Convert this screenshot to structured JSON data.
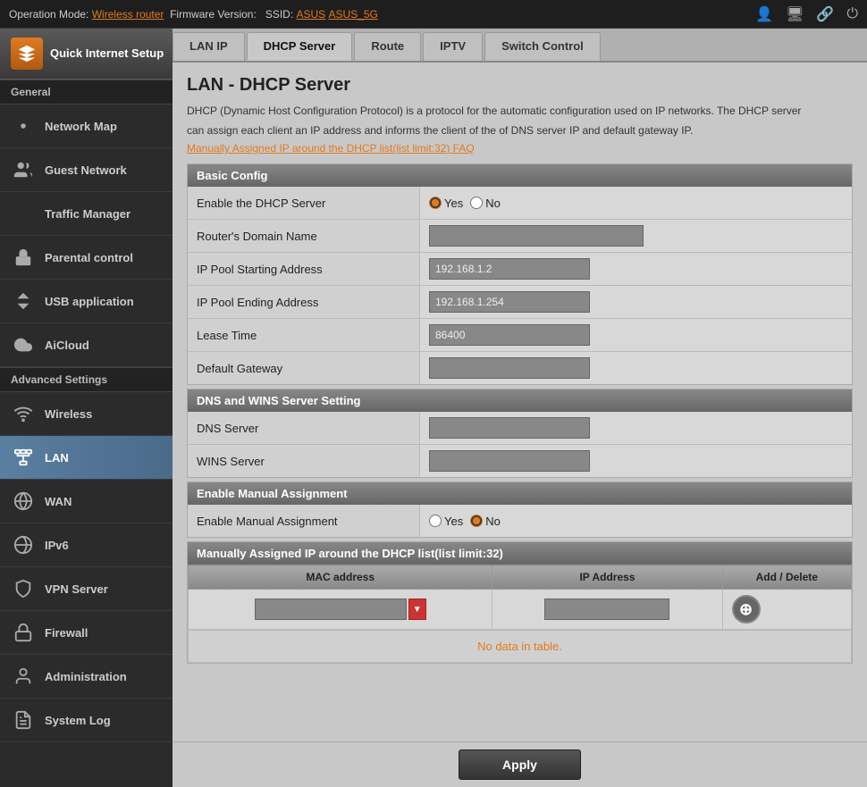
{
  "topbar": {
    "operation_mode_label": "Operation Mode:",
    "operation_mode_value": "Wireless router",
    "firmware_label": "Firmware Version:",
    "ssid_label": "SSID:",
    "ssid_value": "ASUS",
    "ssid_5g_value": "ASUS_5G"
  },
  "sidebar": {
    "quick_setup_label": "Quick Internet Setup",
    "general_label": "General",
    "items_general": [
      {
        "id": "network-map",
        "label": "Network Map"
      },
      {
        "id": "guest-network",
        "label": "Guest Network"
      },
      {
        "id": "traffic-manager",
        "label": "Traffic Manager"
      },
      {
        "id": "parental-control",
        "label": "Parental control"
      },
      {
        "id": "usb-application",
        "label": "USB application"
      },
      {
        "id": "aicloud",
        "label": "AiCloud"
      }
    ],
    "advanced_label": "Advanced Settings",
    "items_advanced": [
      {
        "id": "wireless",
        "label": "Wireless"
      },
      {
        "id": "lan",
        "label": "LAN",
        "active": true
      },
      {
        "id": "wan",
        "label": "WAN"
      },
      {
        "id": "ipv6",
        "label": "IPv6"
      },
      {
        "id": "vpn-server",
        "label": "VPN Server"
      },
      {
        "id": "firewall",
        "label": "Firewall"
      },
      {
        "id": "administration",
        "label": "Administration"
      },
      {
        "id": "system-log",
        "label": "System Log"
      }
    ]
  },
  "tabs": [
    {
      "id": "lan-ip",
      "label": "LAN IP"
    },
    {
      "id": "dhcp-server",
      "label": "DHCP Server",
      "active": true
    },
    {
      "id": "route",
      "label": "Route"
    },
    {
      "id": "iptv",
      "label": "IPTV"
    },
    {
      "id": "switch-control",
      "label": "Switch Control"
    }
  ],
  "page": {
    "title": "LAN - DHCP Server",
    "description1": "DHCP (Dynamic Host Configuration Protocol) is a protocol for the automatic configuration used on IP networks. The DHCP server",
    "description2": "can assign each client an IP address and informs the client of the of DNS server IP and default gateway IP.",
    "faq_link": "Manually Assigned IP around the DHCP list(list limit:32) FAQ"
  },
  "basic_config": {
    "header": "Basic Config",
    "fields": [
      {
        "id": "enable-dhcp",
        "label": "Enable the DHCP Server",
        "type": "radio",
        "options": [
          "Yes",
          "No"
        ],
        "selected": "Yes"
      },
      {
        "id": "router-domain",
        "label": "Router's Domain Name",
        "type": "text",
        "value": ""
      },
      {
        "id": "ip-pool-start",
        "label": "IP Pool Starting Address",
        "type": "text",
        "value": "192.168.1.2"
      },
      {
        "id": "ip-pool-end",
        "label": "IP Pool Ending Address",
        "type": "text",
        "value": "192.168.1.254"
      },
      {
        "id": "lease-time",
        "label": "Lease Time",
        "type": "text",
        "value": "86400"
      },
      {
        "id": "default-gateway",
        "label": "Default Gateway",
        "type": "text",
        "value": ""
      }
    ]
  },
  "dns_wins": {
    "header": "DNS and WINS Server Setting",
    "fields": [
      {
        "id": "dns-server",
        "label": "DNS Server",
        "type": "text",
        "value": ""
      },
      {
        "id": "wins-server",
        "label": "WINS Server",
        "type": "text",
        "value": ""
      }
    ]
  },
  "manual_assignment": {
    "header": "Enable Manual Assignment",
    "fields": [
      {
        "id": "enable-manual",
        "label": "Enable Manual Assignment",
        "type": "radio",
        "options": [
          "Yes",
          "No"
        ],
        "selected": "No"
      }
    ]
  },
  "manual_table": {
    "header": "Manually Assigned IP around the DHCP list(list limit:32)",
    "columns": [
      "MAC address",
      "IP Address",
      "Add / Delete"
    ],
    "no_data": "No data in table.",
    "add_icon": "⊕"
  },
  "apply_btn": "Apply"
}
